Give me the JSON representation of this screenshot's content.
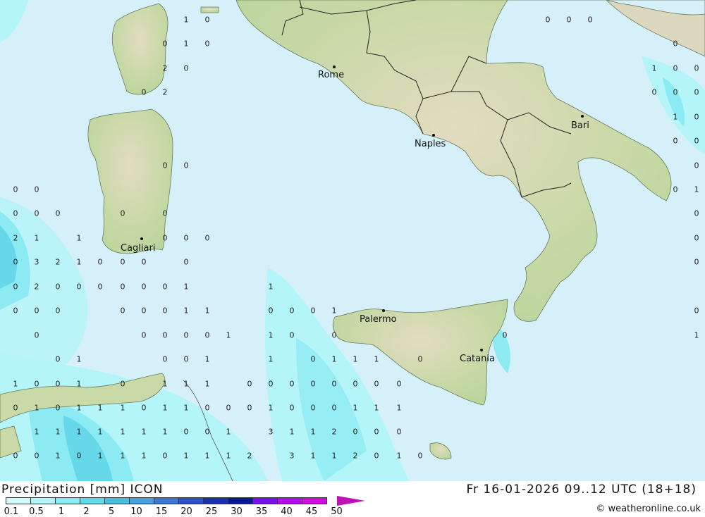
{
  "header": {
    "title": "Precipitation [mm] ICON",
    "datetime": "Fr 16-01-2026 09..12 UTC (18+18)",
    "copyright": "© weatheronline.co.uk"
  },
  "legend": {
    "labels": [
      "0.1",
      "0.5",
      "1",
      "2",
      "5",
      "10",
      "15",
      "20",
      "25",
      "30",
      "35",
      "40",
      "45",
      "50"
    ],
    "colors": [
      "#d6fbfd",
      "#b3f5f8",
      "#8ceaf2",
      "#66d8ea",
      "#4cbce0",
      "#4aa0dc",
      "#3a78d0",
      "#2a52c0",
      "#1a30a8",
      "#0a1890",
      "#7a10e8",
      "#b010e8",
      "#d010d8",
      "#c010b8"
    ]
  },
  "cities": [
    {
      "name": "Rome"
    },
    {
      "name": "Naples"
    },
    {
      "name": "Bari"
    },
    {
      "name": "Cagliari"
    },
    {
      "name": "Palermo"
    },
    {
      "name": "Catania"
    }
  ],
  "values": [
    "1",
    "0",
    "0",
    "0",
    "0",
    "0",
    "1",
    "0",
    "0",
    "2",
    "0",
    "1",
    "0",
    "0",
    "0",
    "2",
    "0",
    "0",
    "0",
    "1",
    "0",
    "0",
    "0",
    "0",
    "0",
    "0",
    "0",
    "0",
    "0",
    "1",
    "0",
    "0",
    "0",
    "0",
    "0",
    "0",
    "2",
    "1",
    "1",
    "0",
    "0",
    "0",
    "0",
    "0",
    "3",
    "2",
    "1",
    "0",
    "0",
    "0",
    "0",
    "0",
    "0",
    "2",
    "0",
    "0",
    "0",
    "0",
    "0",
    "0",
    "1",
    "1",
    "0",
    "0",
    "0",
    "0",
    "0",
    "0",
    "1",
    "1",
    "0",
    "0",
    "0",
    "1",
    "0",
    "0",
    "0",
    "0",
    "0",
    "0",
    "1",
    "1",
    "0",
    "0",
    "0",
    "1",
    "0",
    "1",
    "0",
    "0",
    "1",
    "1",
    "0",
    "1",
    "1",
    "1",
    "0",
    "1",
    "0",
    "0",
    "1",
    "0",
    "1",
    "1",
    "1",
    "0",
    "0",
    "0",
    "0",
    "0",
    "0",
    "0",
    "0",
    "0",
    "1",
    "0",
    "1",
    "1",
    "1",
    "0",
    "1",
    "1",
    "0",
    "0",
    "0",
    "1",
    "0",
    "0",
    "0",
    "1",
    "1",
    "1",
    "1",
    "1",
    "1",
    "1",
    "1",
    "1",
    "1",
    "0",
    "0",
    "1",
    "3",
    "1",
    "1",
    "2",
    "0",
    "0",
    "0",
    "0",
    "0",
    "1",
    "0",
    "1",
    "1",
    "1",
    "0",
    "1",
    "1",
    "1",
    "2",
    "3",
    "1",
    "1",
    "2",
    "0",
    "1",
    "0",
    "0",
    "0",
    "0",
    "1",
    "1",
    "1",
    "0",
    "0"
  ]
}
